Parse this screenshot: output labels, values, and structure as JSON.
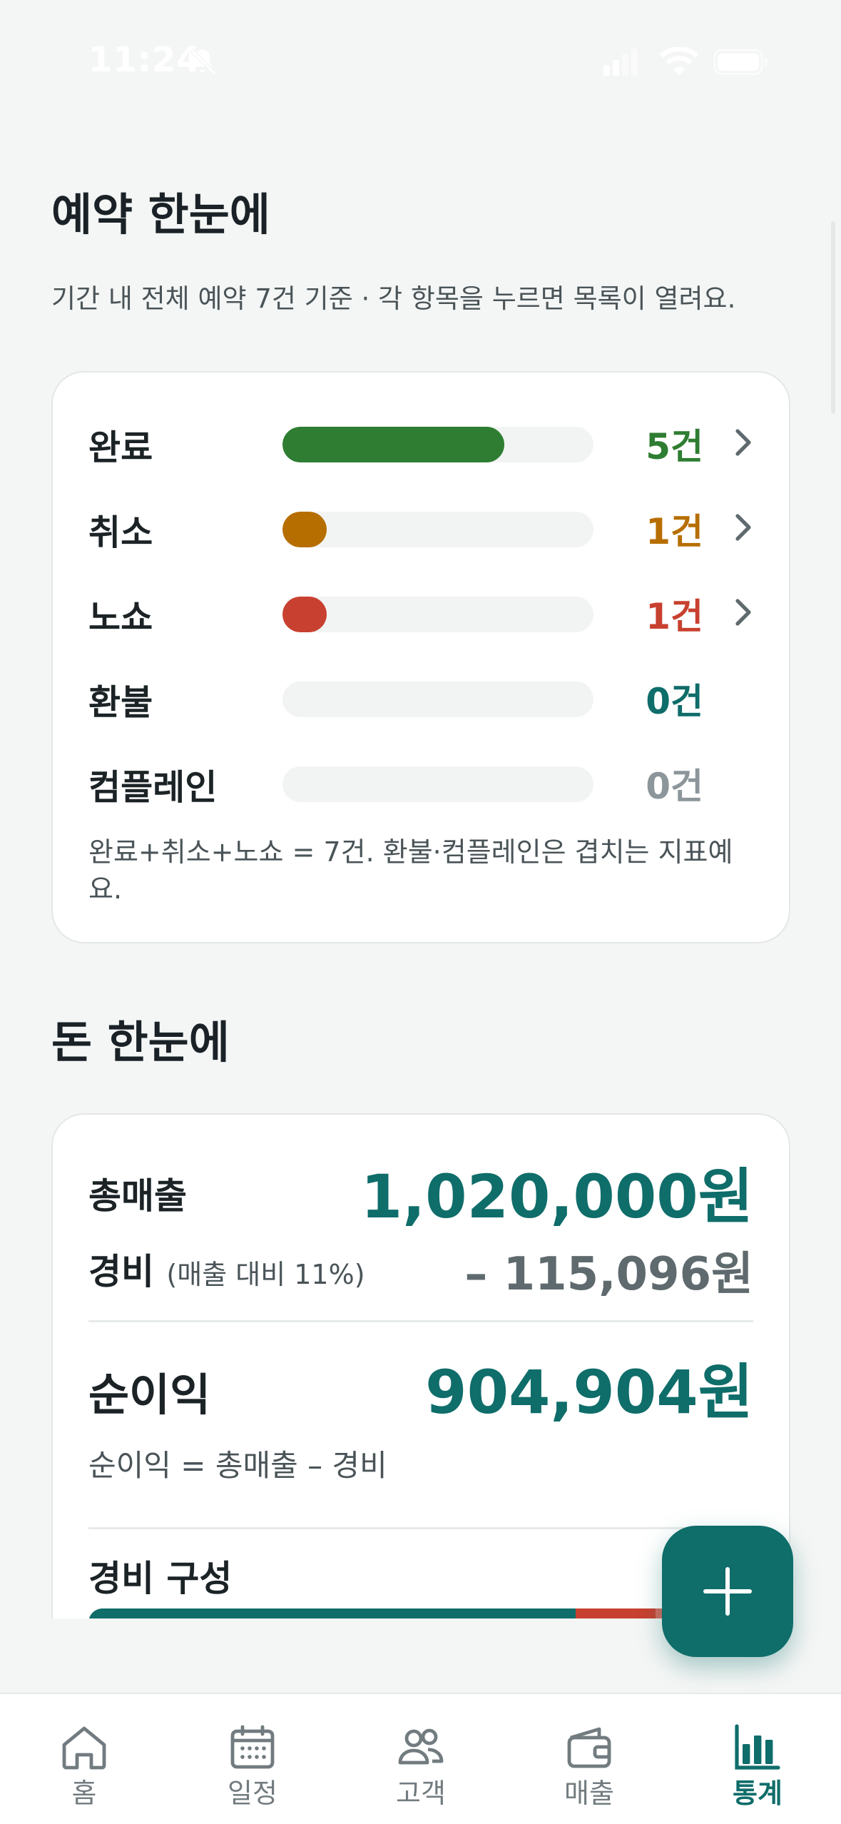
{
  "status": {
    "time": "11:24"
  },
  "booking": {
    "title": "예약 한눈에",
    "subtitle": "기간 내 전체 예약 7건 기준 · 각 항목을 누르면 목록이 열려요.",
    "rows": [
      {
        "label": "완료",
        "count": "5건",
        "fraction": 0.714,
        "color": "#2e7d32",
        "clickable": true
      },
      {
        "label": "취소",
        "count": "1건",
        "fraction": 0.143,
        "color": "#b76e00",
        "clickable": true
      },
      {
        "label": "노쇼",
        "count": "1건",
        "fraction": 0.143,
        "color": "#c8402f",
        "clickable": true
      },
      {
        "label": "환불",
        "count": "0건",
        "fraction": 0,
        "color": "#0f6d6a",
        "clickable": false
      },
      {
        "label": "컴플레인",
        "count": "0건",
        "fraction": 0,
        "color": "#8c969a",
        "clickable": false
      }
    ],
    "note": "완료+취소+노쇼 = 7건. 환불·컴플레인은 겹치는 지표예요."
  },
  "money": {
    "title": "돈 한눈에",
    "revenue_label": "총매출",
    "revenue_value": "1,020,000원",
    "expense_label": "경비",
    "expense_ratio": "(매출 대비 11%)",
    "expense_value": "– 115,096원",
    "profit_label": "순이익",
    "profit_value": "904,904원",
    "formula": "순이익 = 총매출 – 경비",
    "expense_breakdown_title": "경비 구성",
    "expense_breakdown": [
      {
        "fraction": 0.73,
        "color": "#0f6d6a"
      },
      {
        "fraction": 0.12,
        "color": "#c8402f"
      }
    ]
  },
  "colors": {
    "accent": "#0f6d6a",
    "muted": "#5f6a6e"
  },
  "tabs": [
    {
      "label": "홈",
      "icon": "home-icon",
      "active": false
    },
    {
      "label": "일정",
      "icon": "calendar-icon",
      "active": false
    },
    {
      "label": "고객",
      "icon": "users-icon",
      "active": false
    },
    {
      "label": "매출",
      "icon": "wallet-icon",
      "active": false
    },
    {
      "label": "통계",
      "icon": "bar-chart-icon",
      "active": true
    }
  ]
}
